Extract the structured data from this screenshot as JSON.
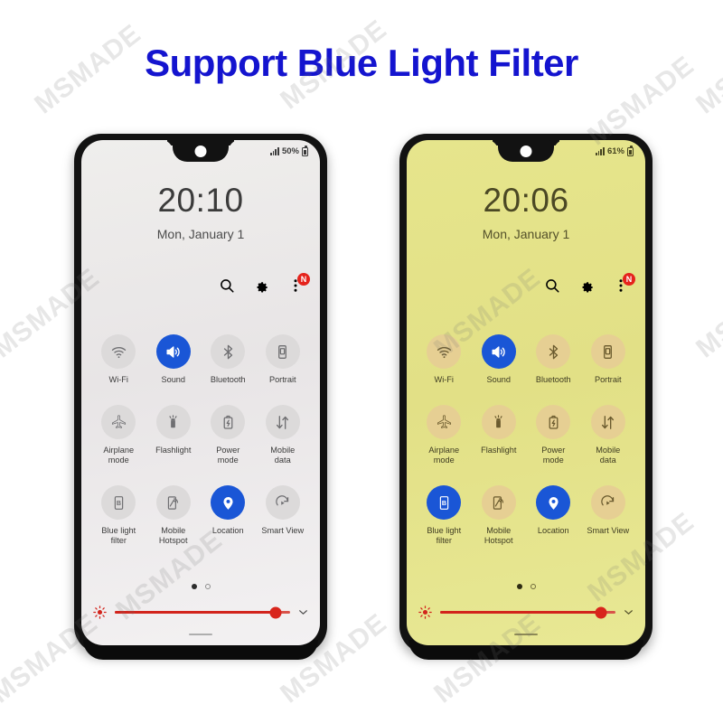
{
  "title": "Support Blue Light Filter",
  "watermark": {
    "text": "MSMADE"
  },
  "theme": {
    "title_color": "#1414cf",
    "accent_blue": "#1a56d6",
    "slider_red": "#d2241c",
    "badge_red": "#e5231c",
    "screen_light": "#e8e5e6",
    "screen_amber": "#e2e086",
    "frame": "#121212"
  },
  "phones": [
    {
      "id": "left",
      "mode": "normal",
      "screen_tint": "light",
      "status": {
        "battery_percent": "50%",
        "signal_icon": "signal-bars-icon",
        "battery_icon": "battery-icon"
      },
      "clock": {
        "time": "20:10",
        "date": "Mon, January 1"
      },
      "actions": [
        {
          "name": "search-icon",
          "label": "Search"
        },
        {
          "name": "gear-icon",
          "label": "Settings"
        },
        {
          "name": "more-options-icon",
          "label": "More options",
          "badge": "N"
        }
      ],
      "tiles": [
        {
          "label": "Wi-Fi",
          "icon": "wifi-icon",
          "active": false
        },
        {
          "label": "Sound",
          "icon": "sound-icon",
          "active": true
        },
        {
          "label": "Bluetooth",
          "icon": "bluetooth-icon",
          "active": false
        },
        {
          "label": "Portrait",
          "icon": "portrait-rotation-icon",
          "active": false
        },
        {
          "label": "Airplane\nmode",
          "icon": "airplane-icon",
          "active": false
        },
        {
          "label": "Flashlight",
          "icon": "flashlight-icon",
          "active": false
        },
        {
          "label": "Power\nmode",
          "icon": "power-mode-icon",
          "active": false
        },
        {
          "label": "Mobile\ndata",
          "icon": "mobile-data-icon",
          "active": false
        },
        {
          "label": "Blue light\nfilter",
          "icon": "blue-light-filter-icon",
          "active": false
        },
        {
          "label": "Mobile\nHotspot",
          "icon": "hotspot-icon",
          "active": false
        },
        {
          "label": "Location",
          "icon": "location-pin-icon",
          "active": true
        },
        {
          "label": "Smart View",
          "icon": "smart-view-icon",
          "active": false
        }
      ],
      "pages": {
        "count": 2,
        "current": 1
      },
      "brightness": {
        "value": 92,
        "sun_icon": "brightness-sun-icon",
        "expand_icon": "chevron-down-icon"
      }
    },
    {
      "id": "right",
      "mode": "blue-light-filter-on",
      "screen_tint": "amber",
      "status": {
        "battery_percent": "61%",
        "signal_icon": "signal-bars-icon",
        "battery_icon": "battery-icon"
      },
      "clock": {
        "time": "20:06",
        "date": "Mon, January 1"
      },
      "actions": [
        {
          "name": "search-icon",
          "label": "Search"
        },
        {
          "name": "gear-icon",
          "label": "Settings"
        },
        {
          "name": "more-options-icon",
          "label": "More options",
          "badge": "N"
        }
      ],
      "tiles": [
        {
          "label": "Wi-Fi",
          "icon": "wifi-icon",
          "active": false
        },
        {
          "label": "Sound",
          "icon": "sound-icon",
          "active": true
        },
        {
          "label": "Bluetooth",
          "icon": "bluetooth-icon",
          "active": false
        },
        {
          "label": "Portrait",
          "icon": "portrait-rotation-icon",
          "active": false
        },
        {
          "label": "Airplane\nmode",
          "icon": "airplane-icon",
          "active": false
        },
        {
          "label": "Flashlight",
          "icon": "flashlight-icon",
          "active": false
        },
        {
          "label": "Power\nmode",
          "icon": "power-mode-icon",
          "active": false
        },
        {
          "label": "Mobile\ndata",
          "icon": "mobile-data-icon",
          "active": false
        },
        {
          "label": "Blue light\nfilter",
          "icon": "blue-light-filter-icon",
          "active": true
        },
        {
          "label": "Mobile\nHotspot",
          "icon": "hotspot-icon",
          "active": false
        },
        {
          "label": "Location",
          "icon": "location-pin-icon",
          "active": true
        },
        {
          "label": "Smart View",
          "icon": "smart-view-icon",
          "active": false
        }
      ],
      "pages": {
        "count": 2,
        "current": 1
      },
      "brightness": {
        "value": 92,
        "sun_icon": "brightness-sun-icon",
        "expand_icon": "chevron-down-icon"
      }
    }
  ]
}
